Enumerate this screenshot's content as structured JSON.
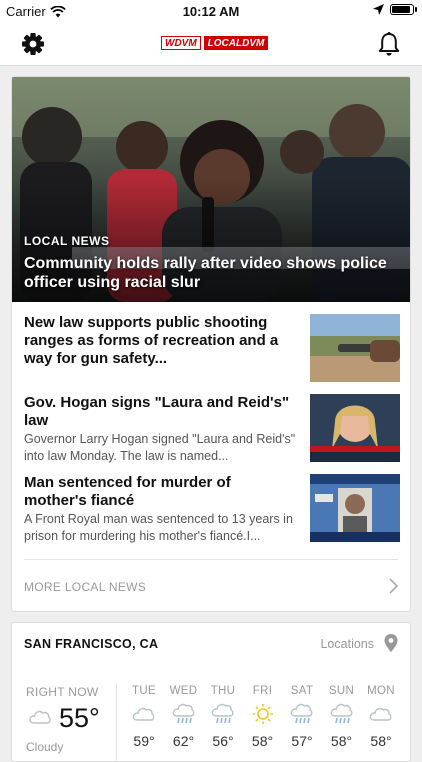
{
  "status": {
    "carrier": "Carrier",
    "time": "10:12 AM",
    "battery_level": 0.9
  },
  "nav": {
    "logo_left": "WDVM",
    "logo_right": "LOCALDVM",
    "settings_icon": "gear-icon",
    "notifications_icon": "bell-icon"
  },
  "hero": {
    "category": "LOCAL NEWS",
    "title": "Community holds rally after video shows police officer using racial slur"
  },
  "stories": [
    {
      "title": "New law supports public shooting ranges as forms of recreation and a way for gun safety...",
      "summary": ""
    },
    {
      "title": "Gov. Hogan signs \"Laura and Reid's\" law",
      "summary": "Governor Larry Hogan signed \"Laura and Reid's\" into law Monday. The law is named..."
    },
    {
      "title": "Man sentenced for murder of mother's fiancé",
      "summary": "A Front Royal man was sentenced to 13 years in prison for murdering his mother's fiancé.I..."
    }
  ],
  "more": {
    "label": "MORE LOCAL NEWS"
  },
  "weather": {
    "city": "SAN FRANCISCO, CA",
    "locations_label": "Locations",
    "now": {
      "label": "RIGHT NOW",
      "temp": "55°",
      "condition": "Cloudy",
      "icon": "cloud-icon"
    },
    "forecast": [
      {
        "day": "TUE",
        "temp": "59°",
        "icon": "cloud-icon"
      },
      {
        "day": "WED",
        "temp": "62°",
        "icon": "rain-icon"
      },
      {
        "day": "THU",
        "temp": "56°",
        "icon": "rain-icon"
      },
      {
        "day": "FRI",
        "temp": "58°",
        "icon": "sun-icon"
      },
      {
        "day": "SAT",
        "temp": "57°",
        "icon": "rain-icon"
      },
      {
        "day": "SUN",
        "temp": "58°",
        "icon": "rain-icon"
      },
      {
        "day": "MON",
        "temp": "58°",
        "icon": "cloud-icon"
      }
    ]
  },
  "colors": {
    "accent": "#c00000",
    "sun": "#f5c518",
    "icon_gray": "#b9c2c8",
    "rain": "#8fb8d8"
  }
}
